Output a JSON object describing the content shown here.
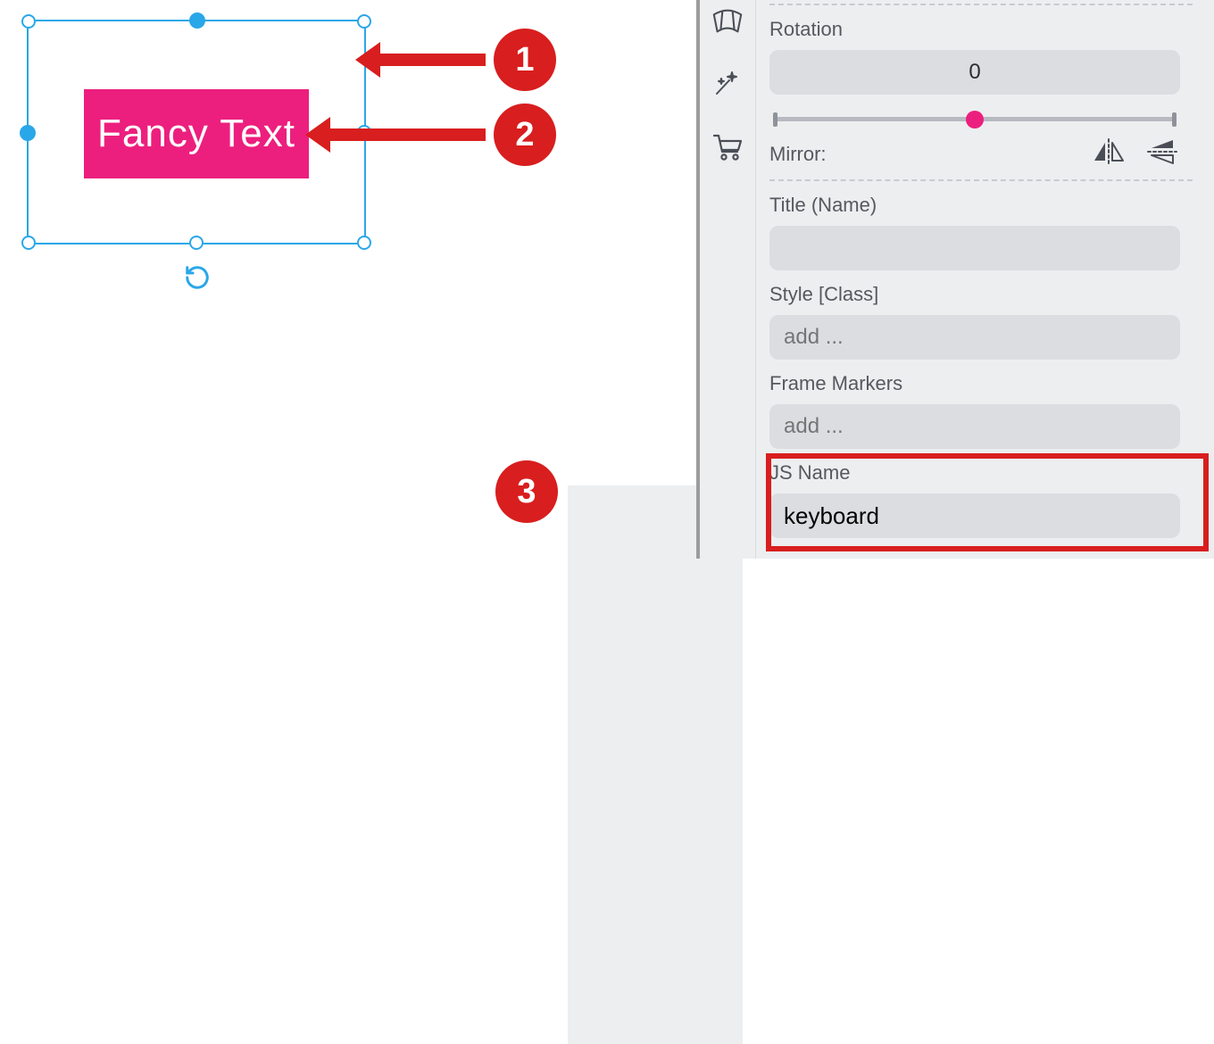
{
  "canvas": {
    "widget_text": "Fancy Text"
  },
  "callouts": {
    "one": "1",
    "two": "2",
    "three": "3"
  },
  "panel": {
    "rotation_label": "Rotation",
    "rotation_value": "0",
    "mirror_label": "Mirror:",
    "title_label": "Title (Name)",
    "title_value": "",
    "style_label": "Style [Class]",
    "style_placeholder": "add ...",
    "frame_label": "Frame Markers",
    "frame_placeholder": "add ...",
    "jsname_label": "JS Name",
    "jsname_value": "keyboard"
  }
}
